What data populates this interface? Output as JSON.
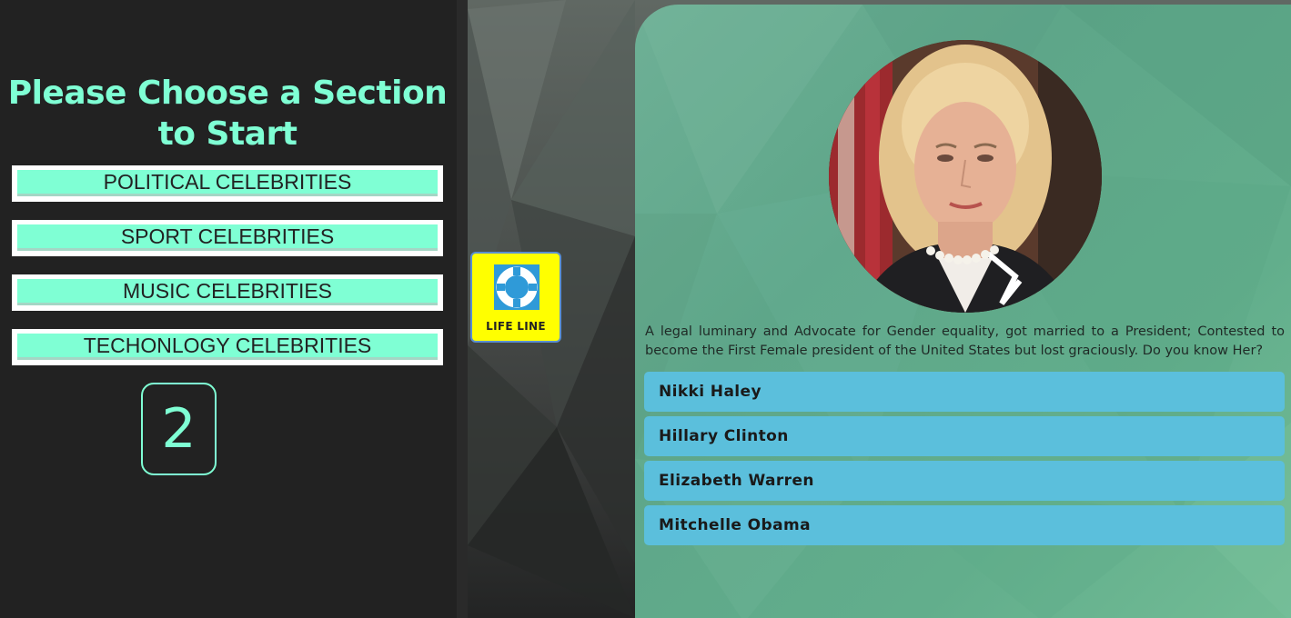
{
  "sidebar": {
    "title": "Please Choose a Section to Start",
    "sections": [
      {
        "label": "POLITICAL CELEBRITIES"
      },
      {
        "label": "SPORT CELEBRITIES"
      },
      {
        "label": "MUSIC CELEBRITIES"
      },
      {
        "label": "TECHONLOGY CELEBRITIES"
      }
    ],
    "counter": "2"
  },
  "lifeline": {
    "label": "LIFE LINE",
    "icon": "lifebuoy-icon"
  },
  "quiz": {
    "question": "A legal luminary and Advocate for Gender equality, got married to a President; Contested to become the First Female president of the United States but lost graciously. Do you know Her?",
    "answers": [
      {
        "label": "Nikki Haley"
      },
      {
        "label": "Hillary Clinton"
      },
      {
        "label": "Elizabeth Warren"
      },
      {
        "label": "Mitchelle Obama"
      }
    ]
  },
  "colors": {
    "accent": "#7fffd4",
    "panel_bg": "#222222",
    "card_bg": "#62ae8c",
    "answer_bg": "#5bbfdc",
    "lifeline_bg": "#ffff00"
  }
}
